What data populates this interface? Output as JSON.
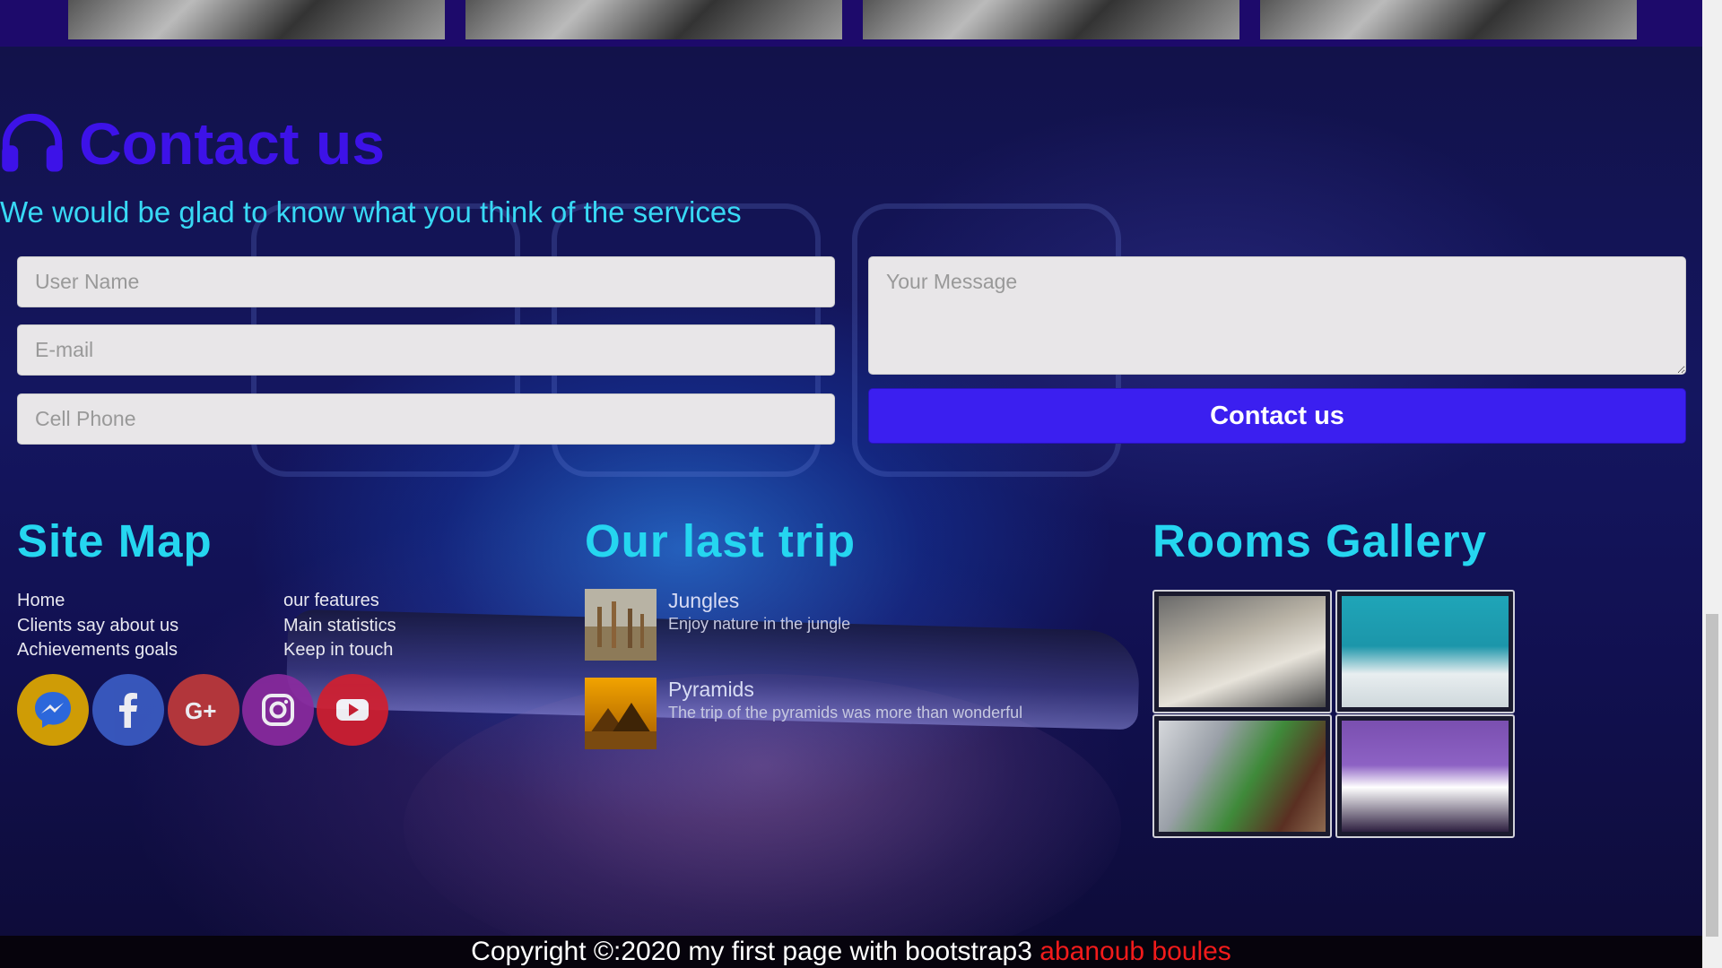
{
  "contact": {
    "title": "Contact us",
    "subtitle": "We would be glad to know what you think of the services",
    "fields": {
      "username_placeholder": "User Name",
      "email_placeholder": "E-mail",
      "phone_placeholder": "Cell Phone",
      "message_placeholder": "Your Message"
    },
    "submit_label": "Contact us"
  },
  "sitemap": {
    "title": "Site Map",
    "links": [
      "Home",
      "Clients say about us",
      "Achievements goals",
      "our features",
      "Main statistics",
      "Keep in touch"
    ]
  },
  "social": [
    {
      "icon": "messenger-icon",
      "color": "#f0b400"
    },
    {
      "icon": "facebook-icon",
      "color": "#3b5cc4"
    },
    {
      "icon": "google-plus-icon",
      "color": "#c03a3a"
    },
    {
      "icon": "instagram-icon",
      "color": "#8a2a9e"
    },
    {
      "icon": "youtube-icon",
      "color": "#d11f2f"
    }
  ],
  "trip": {
    "title": "Our last trip",
    "items": [
      {
        "title": "Jungles",
        "desc": "Enjoy nature in the jungle"
      },
      {
        "title": "Pyramids",
        "desc": "The trip of the pyramids was more than wonderful"
      }
    ]
  },
  "gallery": {
    "title": "Rooms Gallery"
  },
  "footer": {
    "copyright": "Copyright ©:2020 my first page with bootstrap3",
    "author": "abanoub boules"
  },
  "colors": {
    "accent": "#3b1ff0",
    "heading_cyan": "#25d6f0",
    "author_red": "#f21b1b"
  }
}
